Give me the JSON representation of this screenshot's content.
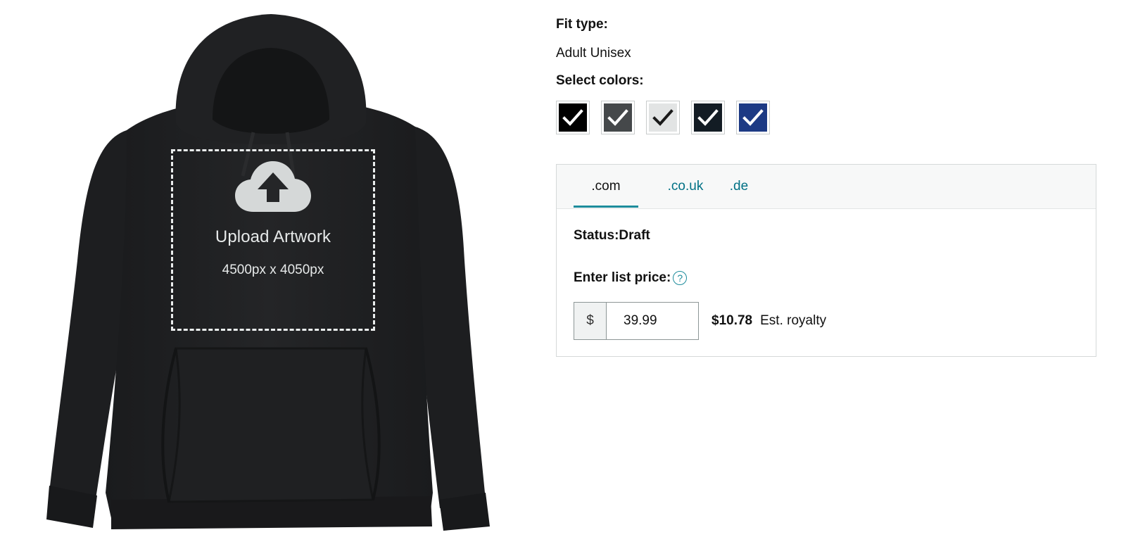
{
  "mockup": {
    "product": "hoodie",
    "upload_icon": "cloud-upload-icon",
    "upload_title": "Upload Artwork",
    "upload_dimensions": "4500px x 4050px"
  },
  "fit": {
    "label": "Fit type:",
    "value": "Adult Unisex"
  },
  "colors": {
    "label": "Select colors:",
    "swatches": [
      {
        "color": "#000000",
        "check": "#ffffff",
        "selected": true
      },
      {
        "color": "#45484a",
        "check": "#ffffff",
        "selected": true
      },
      {
        "color": "#e2e4e4",
        "check": "#1a1a1a",
        "selected": true
      },
      {
        "color": "#131c24",
        "check": "#ffffff",
        "selected": true
      },
      {
        "color": "#1d3a84",
        "check": "#ffffff",
        "selected": true
      }
    ]
  },
  "marketplace": {
    "tabs": [
      {
        "label": ".com",
        "active": true
      },
      {
        "label": ".co.uk",
        "active": false
      },
      {
        "label": ".de",
        "active": false
      }
    ],
    "status": "Status:Draft",
    "price_label": "Enter list price:",
    "help_icon": "question-circle-icon",
    "currency_symbol": "$",
    "price_value": "39.99",
    "royalty_amount": "$10.78",
    "royalty_label": "Est. royalty"
  },
  "accent_color": "#1d8c9c",
  "link_color": "#007185"
}
